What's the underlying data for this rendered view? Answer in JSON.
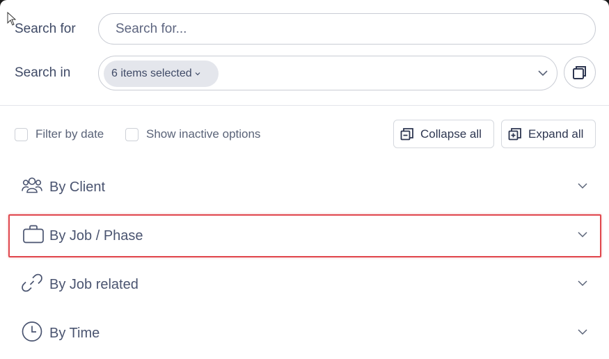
{
  "search": {
    "label": "Search for",
    "placeholder": "Search for...",
    "value": ""
  },
  "search_in": {
    "label": "Search in",
    "chip": "6 items selected"
  },
  "filters": {
    "filter_by_date": "Filter by date",
    "show_inactive": "Show inactive options"
  },
  "actions": {
    "collapse_all": "Collapse all",
    "expand_all": "Expand all"
  },
  "sections": [
    {
      "label": "By Client",
      "icon": "users-icon"
    },
    {
      "label": "By Job / Phase",
      "icon": "briefcase-icon",
      "highlighted": true
    },
    {
      "label": "By Job related",
      "icon": "link-icon"
    },
    {
      "label": "By Time",
      "icon": "clock-icon"
    }
  ],
  "colors": {
    "text": "#3f4a66",
    "border": "#c9ccd4",
    "chip_bg": "#e4e6ec",
    "highlight": "#e0484e"
  }
}
